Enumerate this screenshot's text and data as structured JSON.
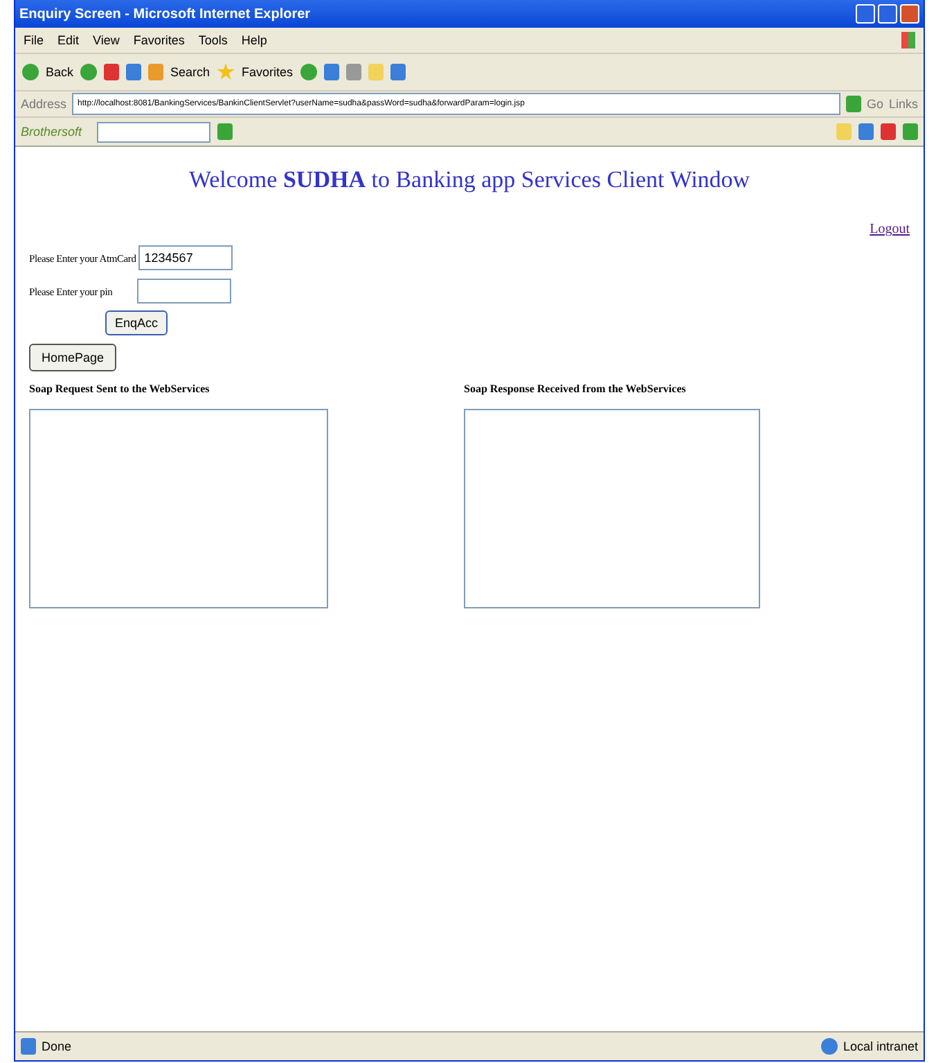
{
  "window": {
    "title": "Enquiry Screen - Microsoft Internet Explorer"
  },
  "menu": [
    "File",
    "Edit",
    "View",
    "Favorites",
    "Tools",
    "Help"
  ],
  "toolbar": {
    "back": "Back",
    "search": "Search",
    "favorites": "Favorites"
  },
  "address": {
    "label": "Address",
    "value": "http://localhost:8081/BankingServices/BankinClientServlet?userName=sudha&passWord=sudha&forwardParam=login.jsp",
    "go": "Go",
    "links": "Links"
  },
  "links_bar": {
    "brand": "Brothersoft"
  },
  "page": {
    "welcome": "Welcome **SUDHA** to Banking app Services Client Window",
    "logout": "Logout",
    "fields": [
      {
        "label": "Please Enter your AtmCard",
        "value": "1234567"
      },
      {
        "label": "Please Enter your pin"
      }
    ],
    "submit": "EnqAcc",
    "home": "HomePage",
    "panels": [
      {
        "title": "Soap Request Sent to the WebServices"
      },
      {
        "title": "Soap Response Received from the WebServices"
      }
    ]
  },
  "status_bar": {
    "text": "Done",
    "zone": "Local intranet"
  }
}
